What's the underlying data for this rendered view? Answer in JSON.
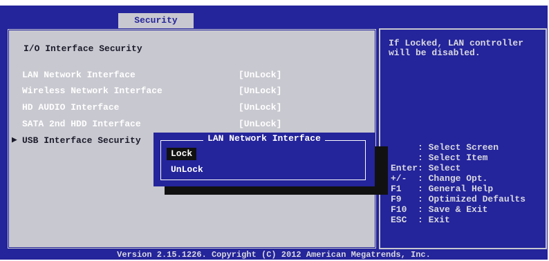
{
  "tabs": [
    {
      "label": "Security"
    }
  ],
  "main": {
    "section_title": "I/O Interface Security",
    "items": [
      {
        "label": "LAN Network Interface",
        "value": "[UnLock]"
      },
      {
        "label": "Wireless Network Interface",
        "value": "[UnLock]"
      },
      {
        "label": "HD AUDIO Interface",
        "value": "[UnLock]"
      },
      {
        "label": "SATA 2nd HDD Interface",
        "value": "[UnLock]"
      },
      {
        "label": "USB Interface Security",
        "value": ""
      }
    ],
    "submenu_arrow": "▶"
  },
  "dialog": {
    "title": "LAN Network Interface",
    "options": [
      {
        "label": "Lock",
        "selected": true
      },
      {
        "label": "UnLock",
        "selected": false
      }
    ]
  },
  "help": {
    "line1": "If Locked, LAN controller",
    "line2": "will be disabled.",
    "keys": [
      "     : Select Screen",
      "     : Select Item",
      "Enter: Select",
      "+/-  : Change Opt.",
      "F1   : General Help",
      "F9   : Optimized Defaults",
      "F10  : Save & Exit",
      "ESC  : Exit"
    ]
  },
  "footer": "Version 2.15.1226. Copyright (C) 2012 American Megatrends, Inc.",
  "colors": {
    "background": "#24249b",
    "panel": "#c8c8d0",
    "highlight": "#111111"
  }
}
